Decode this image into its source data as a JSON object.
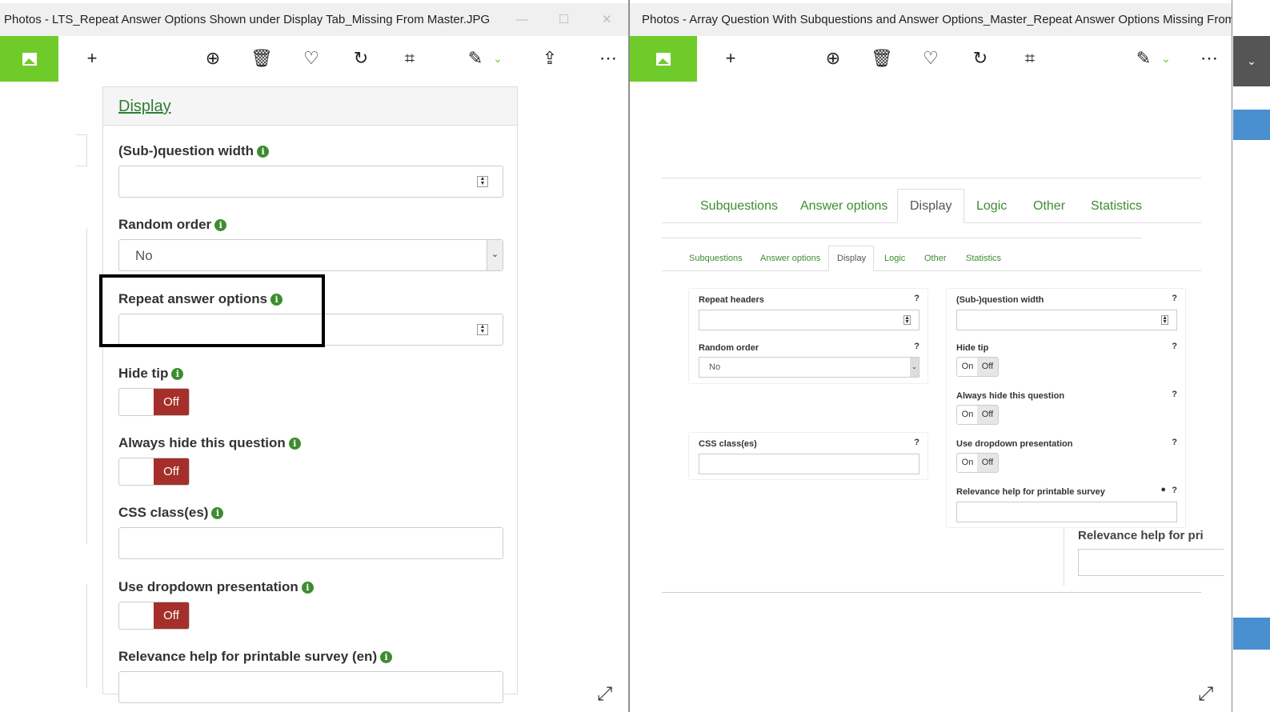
{
  "left_window": {
    "title": "Photos - LTS_Repeat Answer Options Shown under Display Tab_Missing From Master.JPG",
    "panel_header": "Display",
    "fields": {
      "question_width": "(Sub-)question width",
      "random_order": "Random order",
      "random_order_value": "No",
      "repeat_answer_options": "Repeat answer options",
      "hide_tip": "Hide tip",
      "always_hide": "Always hide this question",
      "css_classes": "CSS class(es)",
      "dropdown": "Use dropdown presentation",
      "relevance_help": "Relevance help for printable survey (en)"
    },
    "toggle_off": "Off",
    "info_icon": "i"
  },
  "right_window": {
    "title": "Photos - Array Question With Subquestions and Answer Options_Master_Repeat Answer Options Missing From D",
    "tabs": [
      "Subquestions",
      "Answer options",
      "Display",
      "Logic",
      "Other",
      "Statistics"
    ],
    "fields": {
      "repeat_headers": "Repeat headers",
      "random_order": "Random order",
      "random_order_value": "No",
      "css_classes": "CSS class(es)",
      "question_width": "(Sub-)question width",
      "hide_tip": "Hide tip",
      "always_hide": "Always hide this question",
      "dropdown": "Use dropdown presentation",
      "relevance_help": "Relevance help for printable survey",
      "relevance_partial": "Relevance help for pri"
    },
    "on": "On",
    "off": "Off",
    "help": "?"
  },
  "colors": {
    "accent_green": "#6fcb2a",
    "link_green": "#3c8d2f",
    "off_red": "#a42f2b"
  }
}
